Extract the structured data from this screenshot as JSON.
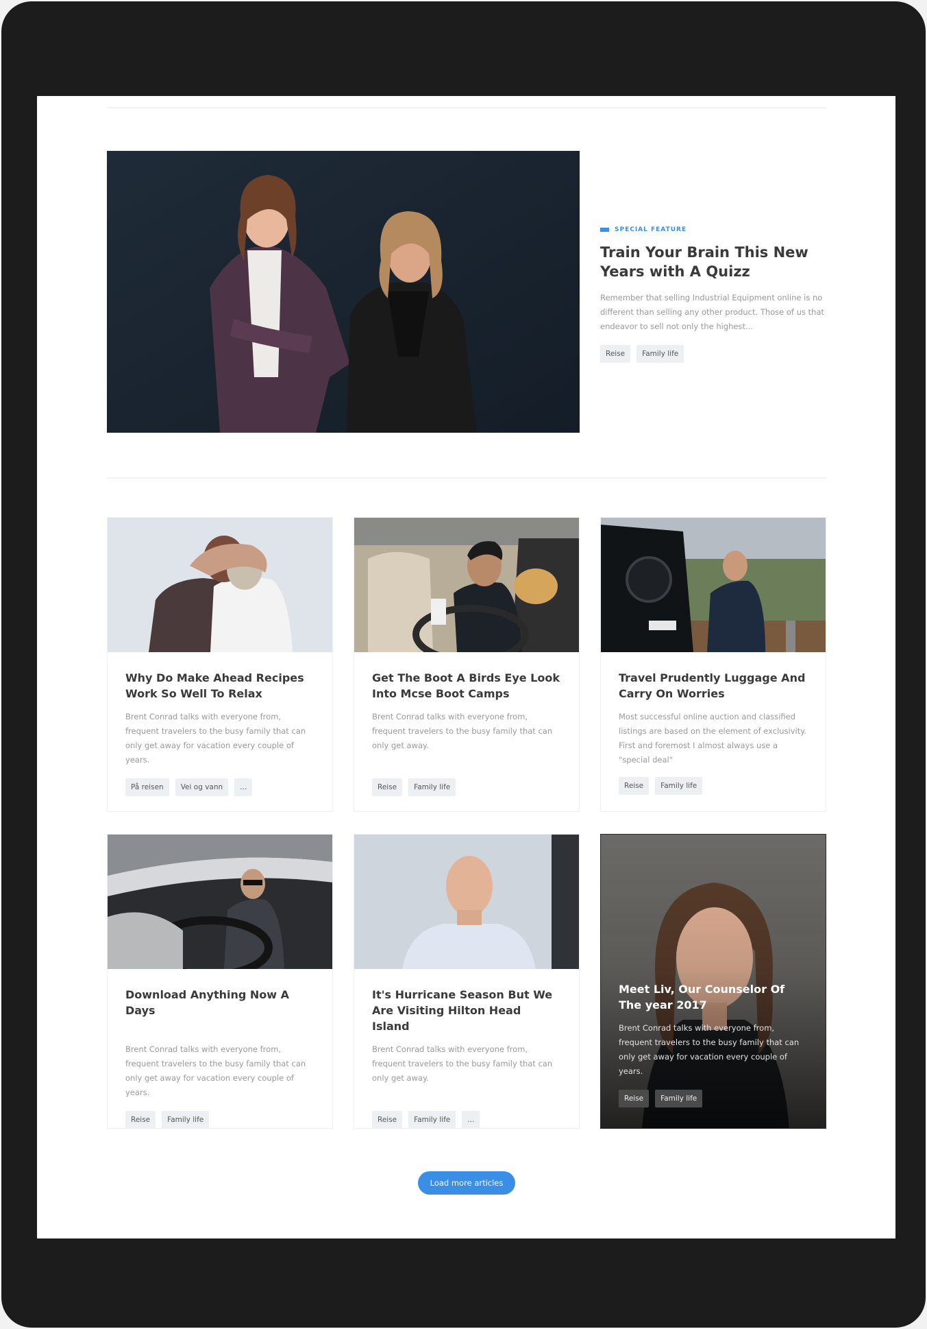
{
  "featured": {
    "label": "SPECIAL FEATURE",
    "title": "Train Your Brain This New Years with A Quizz",
    "description": "Remember that selling Industrial Equipment online is no different than selling any other product. Those of us that endeavor to sell not only the highest...",
    "tags": [
      "Reise",
      "Family life"
    ]
  },
  "cards": [
    {
      "title": "Why Do Make Ahead Recipes Work So Well To Relax",
      "description": "Brent Conrad talks with everyone from, frequent travelers to the busy family that can only get away for vacation every couple of years.",
      "tags": [
        "På reisen",
        "Vei og vann",
        "..."
      ]
    },
    {
      "title": "Get The Boot A Birds Eye Look Into Mcse Boot Camps",
      "description": "Brent Conrad talks with everyone from, frequent travelers to the busy family that can only get away.",
      "tags": [
        "Reise",
        "Family life"
      ]
    },
    {
      "title": "Travel Prudently Luggage And Carry On Worries",
      "description": "Most successful online auction and classified listings are based on the element of exclusivity. First and foremost I almost always use a \"special deal\"",
      "tags": [
        "Reise",
        "Family life"
      ]
    },
    {
      "title": "Download Anything Now A Days",
      "description": "Brent Conrad talks with everyone from, frequent travelers to the busy family that can only get away for vacation every couple of years.",
      "tags": [
        "Reise",
        "Family life"
      ]
    },
    {
      "title": "It's Hurricane Season But We Are Visiting Hilton Head Island",
      "description": "Brent Conrad talks with everyone from, frequent travelers to the busy family that can only get away.",
      "tags": [
        "Reise",
        "Family life",
        "..."
      ]
    },
    {
      "title": "Meet Liv, Our Counselor Of The year 2017",
      "description": "Brent Conrad talks with everyone from, frequent travelers to the busy family that can only get away for vacation every couple of years.",
      "tags": [
        "Reise",
        "Family life"
      ]
    }
  ],
  "load_more": "Load more articles",
  "colors": {
    "accent": "#3a8ee6",
    "tag_bg": "#edf0f3",
    "device": "#1c1c1c"
  }
}
